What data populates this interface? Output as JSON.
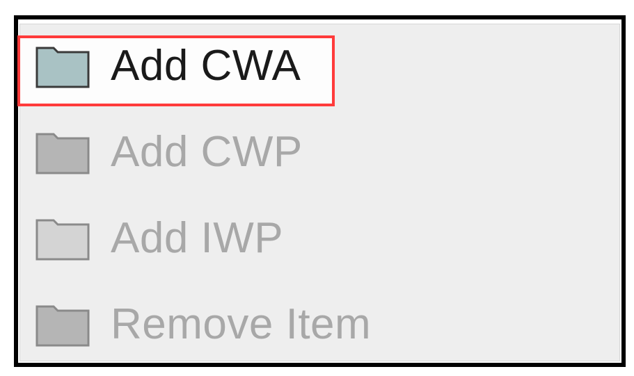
{
  "context_menu": {
    "items": [
      {
        "label": "Add CWA",
        "icon": "folder-icon",
        "enabled": true,
        "highlighted": true,
        "icon_fill": "#a9c2c4"
      },
      {
        "label": "Add CWP",
        "icon": "folder-icon",
        "enabled": false,
        "highlighted": false,
        "icon_fill": "#b5b5b5"
      },
      {
        "label": "Add IWP",
        "icon": "folder-icon",
        "enabled": false,
        "highlighted": false,
        "icon_fill": "#d4d4d4"
      },
      {
        "label": "Remove Item",
        "icon": "folder-icon",
        "enabled": false,
        "highlighted": false,
        "icon_fill": "#b5b5b5"
      }
    ]
  },
  "colors": {
    "highlight_border": "#ff3b3b",
    "frame_border": "#000000",
    "menu_background": "#eeeeee",
    "enabled_text": "#1a1a1a",
    "disabled_text": "#a8a8a8"
  }
}
